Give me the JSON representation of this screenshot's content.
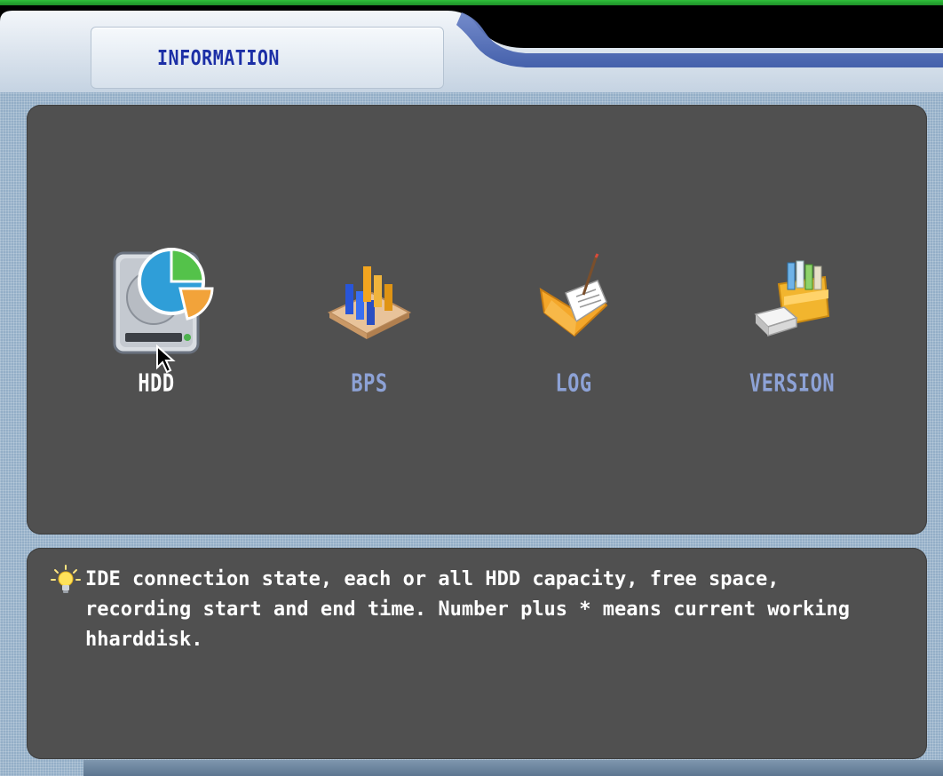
{
  "window": {
    "title": "INFORMATION"
  },
  "menu": {
    "items": [
      {
        "label": "HDD",
        "icon": "hdd-pie-icon",
        "selected": true
      },
      {
        "label": "BPS",
        "icon": "bar-chart-icon",
        "selected": false
      },
      {
        "label": "LOG",
        "icon": "log-folder-icon",
        "selected": false
      },
      {
        "label": "VERSION",
        "icon": "version-drawer-icon",
        "selected": false
      }
    ]
  },
  "help": {
    "icon": "lightbulb-icon",
    "text": "IDE connection state, each or all HDD capacity, free space,\nrecording start and end time. Number plus * means current working\nhharddisk."
  },
  "colors": {
    "panel": "#505050",
    "frame": "#93aec7",
    "title": "#1c2fa6",
    "active_label": "#ffffff",
    "inactive_label": "#8da2d6"
  }
}
